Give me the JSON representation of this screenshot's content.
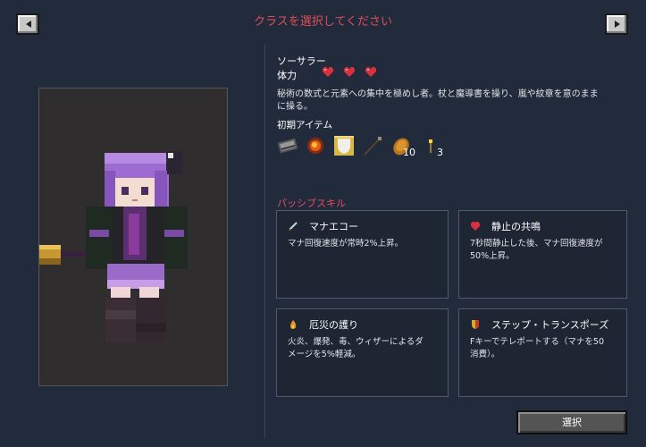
{
  "header": {
    "title": "クラスを選択してください",
    "prev_icon": "arrow-left-icon",
    "next_icon": "arrow-right-icon"
  },
  "class_info": {
    "name": "ソーサラー",
    "hp_label": "体力",
    "hearts": 3,
    "description_line1": "秘術の数式と元素への集中を極めし者。杖と魔導書を操り、嵐や紋章を意のまま",
    "description_line2": "に操る。"
  },
  "items": {
    "label": "初期アイテム",
    "list": [
      {
        "icon": "book-icon"
      },
      {
        "icon": "fire-charge-icon"
      },
      {
        "icon": "shield-icon"
      },
      {
        "icon": "staff-icon"
      },
      {
        "icon": "bread-icon",
        "count": "10"
      },
      {
        "icon": "torch-icon",
        "count": "3"
      }
    ]
  },
  "passive": {
    "label": "パッシブスキル",
    "skills": [
      {
        "icon": "sword-icon",
        "name": "マナエコー",
        "desc_lines": [
          "マナ回復速度が常時2%上昇。"
        ]
      },
      {
        "icon": "heart-icon",
        "name": "静止の共鳴",
        "desc_lines": [
          "7秒間静止した後、マナ回復速度が",
          "50%上昇。"
        ]
      },
      {
        "icon": "flame-charm-icon",
        "name": "厄災の護り",
        "desc_lines": [
          "火炎、爆発、毒、ウィザーによるダ",
          "メージを5%軽減。"
        ]
      },
      {
        "icon": "shield-badge-icon",
        "name": "ステップ・トランスポーズ",
        "desc_lines": [
          "Fキーでテレポートする（マナを50",
          "消費）。"
        ]
      }
    ]
  },
  "footer": {
    "select_label": "選択"
  },
  "colors": {
    "background": "#212b3b",
    "accent_red": "#e24d58",
    "heart": "#d8303c"
  }
}
